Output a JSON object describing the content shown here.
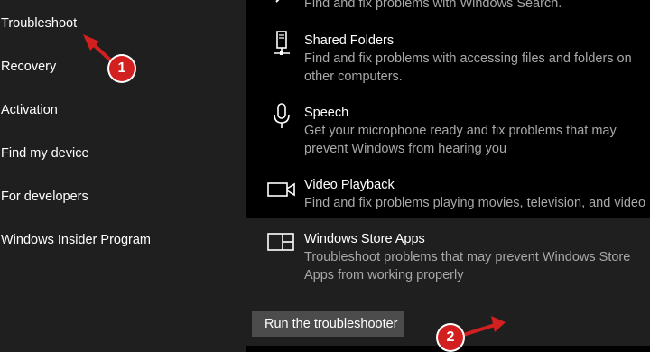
{
  "sidebar": {
    "items": [
      {
        "label": "Troubleshoot"
      },
      {
        "label": "Recovery"
      },
      {
        "label": "Activation"
      },
      {
        "label": "Find my device"
      },
      {
        "label": "For developers"
      },
      {
        "label": "Windows Insider Program"
      }
    ]
  },
  "troubleshooters": [
    {
      "title": "",
      "desc1": "Find and fix problems with Windows Search.",
      "icon": "search-icon"
    },
    {
      "title": "Shared Folders",
      "desc1": "Find and fix problems with accessing files and folders on",
      "desc2": "other computers.",
      "icon": "shared-folder-icon"
    },
    {
      "title": "Speech",
      "desc1": "Get your microphone ready and fix problems that may",
      "desc2": "prevent Windows from hearing you",
      "icon": "microphone-icon"
    },
    {
      "title": "Video Playback",
      "desc1": "Find and fix problems playing movies, television, and video",
      "icon": "video-camera-icon"
    },
    {
      "title": "Windows Store Apps",
      "desc1": "Troubleshoot problems that may prevent Windows Store",
      "desc2": "Apps from working properly",
      "icon": "store-apps-icon"
    }
  ],
  "run_button": {
    "label": "Run the troubleshooter"
  },
  "annotations": {
    "step1": "1",
    "step2": "2",
    "color": "#d21f1f"
  },
  "colors": {
    "sidebar_bg": "#1f1f1f",
    "content_bg": "#000000",
    "button_bg": "#4c4c4c",
    "desc_text": "#a8a8a8"
  }
}
